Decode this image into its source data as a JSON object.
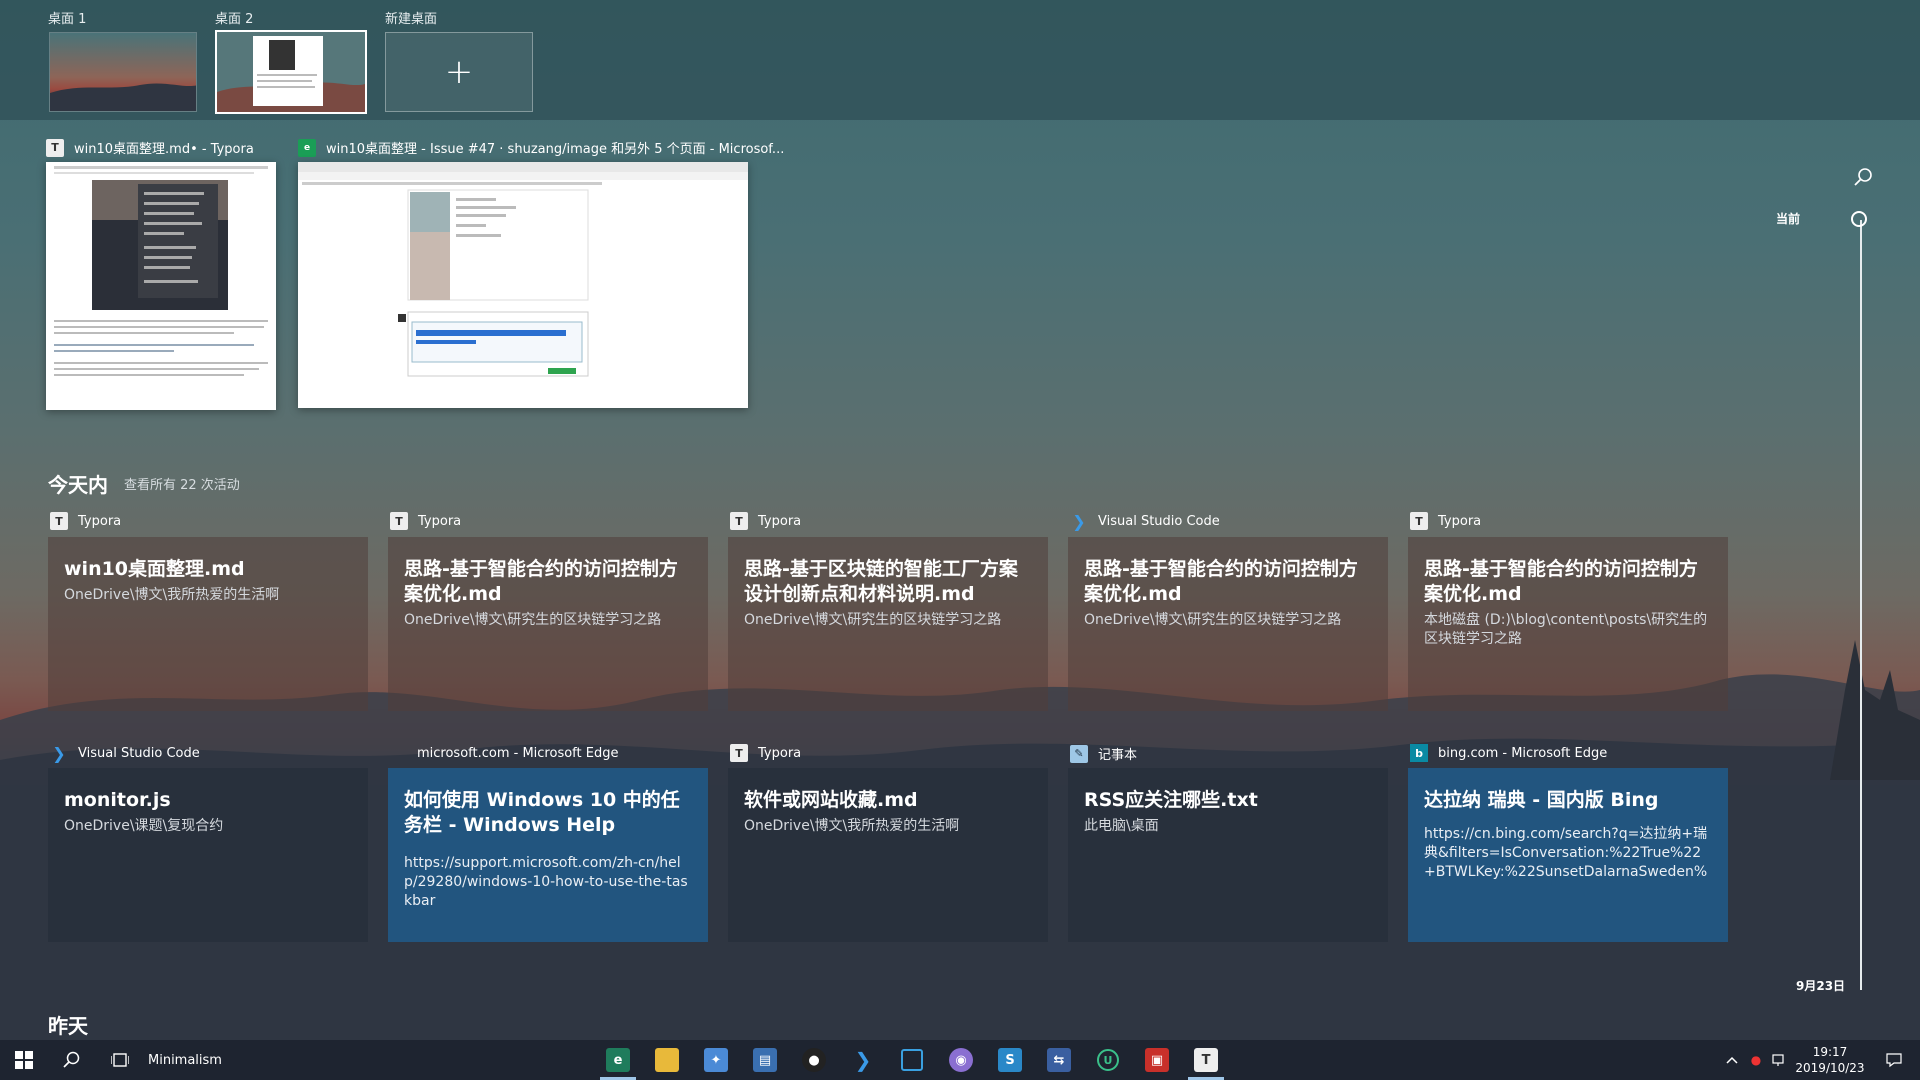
{
  "desktops": [
    {
      "label": "桌面 1"
    },
    {
      "label": "桌面 2"
    },
    {
      "label": "新建桌面"
    }
  ],
  "windows": [
    {
      "title": "win10桌面整理.md• - Typora",
      "icon": "typora-icon"
    },
    {
      "title": "win10桌面整理 - Issue #47 · shuzang/image 和另外 5 个页面 - Microsof...",
      "icon": "edge-icon"
    }
  ],
  "today": {
    "title": "今天内",
    "see_all": "查看所有 22 次活动"
  },
  "activities_row1": [
    {
      "app": "Typora",
      "title": "win10桌面整理.md",
      "path": "OneDrive\\博文\\我所热爱的生活啊"
    },
    {
      "app": "Typora",
      "title": "思路-基于智能合约的访问控制方案优化.md",
      "path": "OneDrive\\博文\\研究生的区块链学习之路"
    },
    {
      "app": "Typora",
      "title": "思路-基于区块链的智能工厂方案设计创新点和材料说明.md",
      "path": "OneDrive\\博文\\研究生的区块链学习之路"
    },
    {
      "app": "Visual Studio Code",
      "title": "思路-基于智能合约的访问控制方案优化.md",
      "path": "OneDrive\\博文\\研究生的区块链学习之路"
    },
    {
      "app": "Typora",
      "title": "思路-基于智能合约的访问控制方案优化.md",
      "path": "本地磁盘 (D:)\\blog\\content\\posts\\研究生的区块链学习之路"
    }
  ],
  "activities_row2": [
    {
      "app": "Visual Studio Code",
      "title": "monitor.js",
      "path": "OneDrive\\课题\\复现合约"
    },
    {
      "app": "microsoft.com - Microsoft Edge",
      "title": "如何使用 Windows 10 中的任务栏 - Windows Help",
      "path": "https://support.microsoft.com/zh-cn/help/29280/windows-10-how-to-use-the-taskbar"
    },
    {
      "app": "Typora",
      "title": "软件或网站收藏.md",
      "path": "OneDrive\\博文\\我所热爱的生活啊"
    },
    {
      "app": "记事本",
      "title": "RSS应关注哪些.txt",
      "path": "此电脑\\桌面"
    },
    {
      "app": "bing.com - Microsoft Edge",
      "title": "达拉纳 瑞典 - 国内版 Bing",
      "path": "https://cn.bing.com/search?q=达拉纳+瑞典&filters=IsConversation:%22True%22+BTWLKey:%22SunsetDalarnaSweden%2..."
    }
  ],
  "yesterday": {
    "title": "昨天"
  },
  "timeline": {
    "current_label": "当前",
    "date_label": "9月23日"
  },
  "taskbar": {
    "search_button_name": "Minimalism",
    "time": "19:17",
    "date": "2019/10/23"
  },
  "colors": {
    "accent": "#22557f",
    "taskbar": "#1e2430"
  }
}
